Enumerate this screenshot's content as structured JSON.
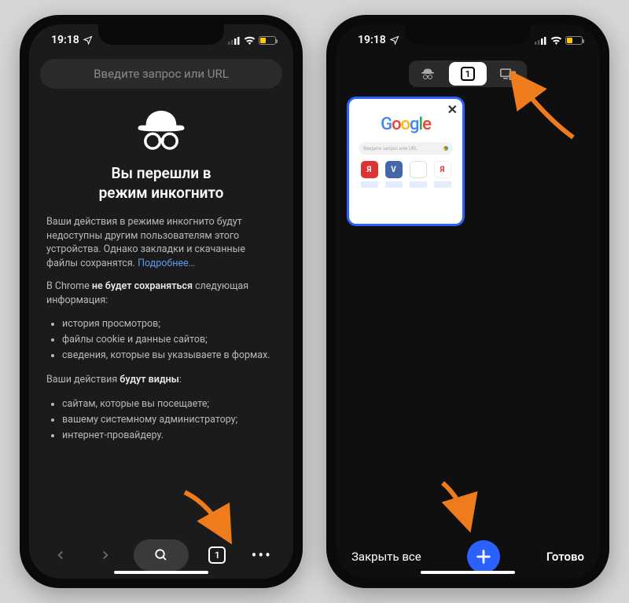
{
  "status": {
    "time": "19:18"
  },
  "screen1": {
    "url_placeholder": "Введите запрос или URL",
    "title_line1": "Вы перешли в",
    "title_line2": "режим инкогнито",
    "para1": "Ваши действия в режиме инкогнито будут недоступны другим пользователям этого устройства. Однако закладки и скачанные файлы сохранятся.",
    "more_link": "Подробнее…",
    "para2_pre": "В Chrome ",
    "para2_bold": "не будет сохраняться",
    "para2_post": " следующая информация:",
    "list1": [
      "история просмотров;",
      "файлы cookie и данные сайтов;",
      "сведения, которые вы указываете в формах."
    ],
    "para3_pre": "Ваши действия ",
    "para3_bold": "будут видны",
    "para3_post": ":",
    "list2": [
      "сайтам, которые вы посещаете;",
      "вашему системному администратору;",
      "интернет-провайдеру."
    ],
    "tab_count": "1"
  },
  "screen2": {
    "seg_tab_count": "1",
    "card_search_placeholder": "Введите запрос или URL",
    "close_all": "Закрыть все",
    "done": "Готово"
  }
}
